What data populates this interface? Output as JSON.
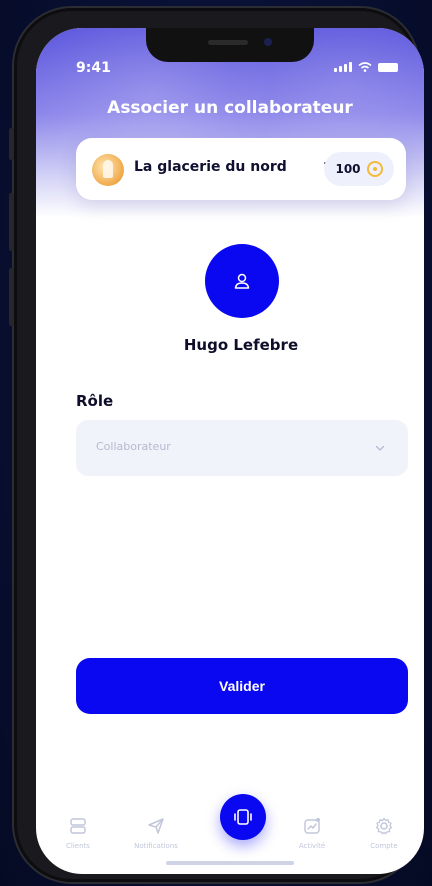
{
  "status_bar": {
    "time": "9:41"
  },
  "header": {
    "title": "Associer un collaborateur"
  },
  "store": {
    "name": "La glacerie du nord",
    "credits": "100"
  },
  "user": {
    "name": "Hugo Lefebre"
  },
  "form": {
    "role_label": "Rôle",
    "role_placeholder": "Collaborateur"
  },
  "actions": {
    "validate_label": "Valider"
  },
  "tabbar": {
    "tabs": [
      {
        "label": "Clients",
        "icon": "clients-icon"
      },
      {
        "label": "Notifications",
        "icon": "send-icon"
      },
      {
        "label": "Activité",
        "icon": "activity-icon"
      },
      {
        "label": "Compte",
        "icon": "gear-icon"
      }
    ],
    "center_icon": "switch-icon"
  },
  "colors": {
    "accent": "#0a08f0",
    "header_top": "#5c57dd",
    "field_bg": "#f1f3fa",
    "coin": "#f5b93b"
  }
}
